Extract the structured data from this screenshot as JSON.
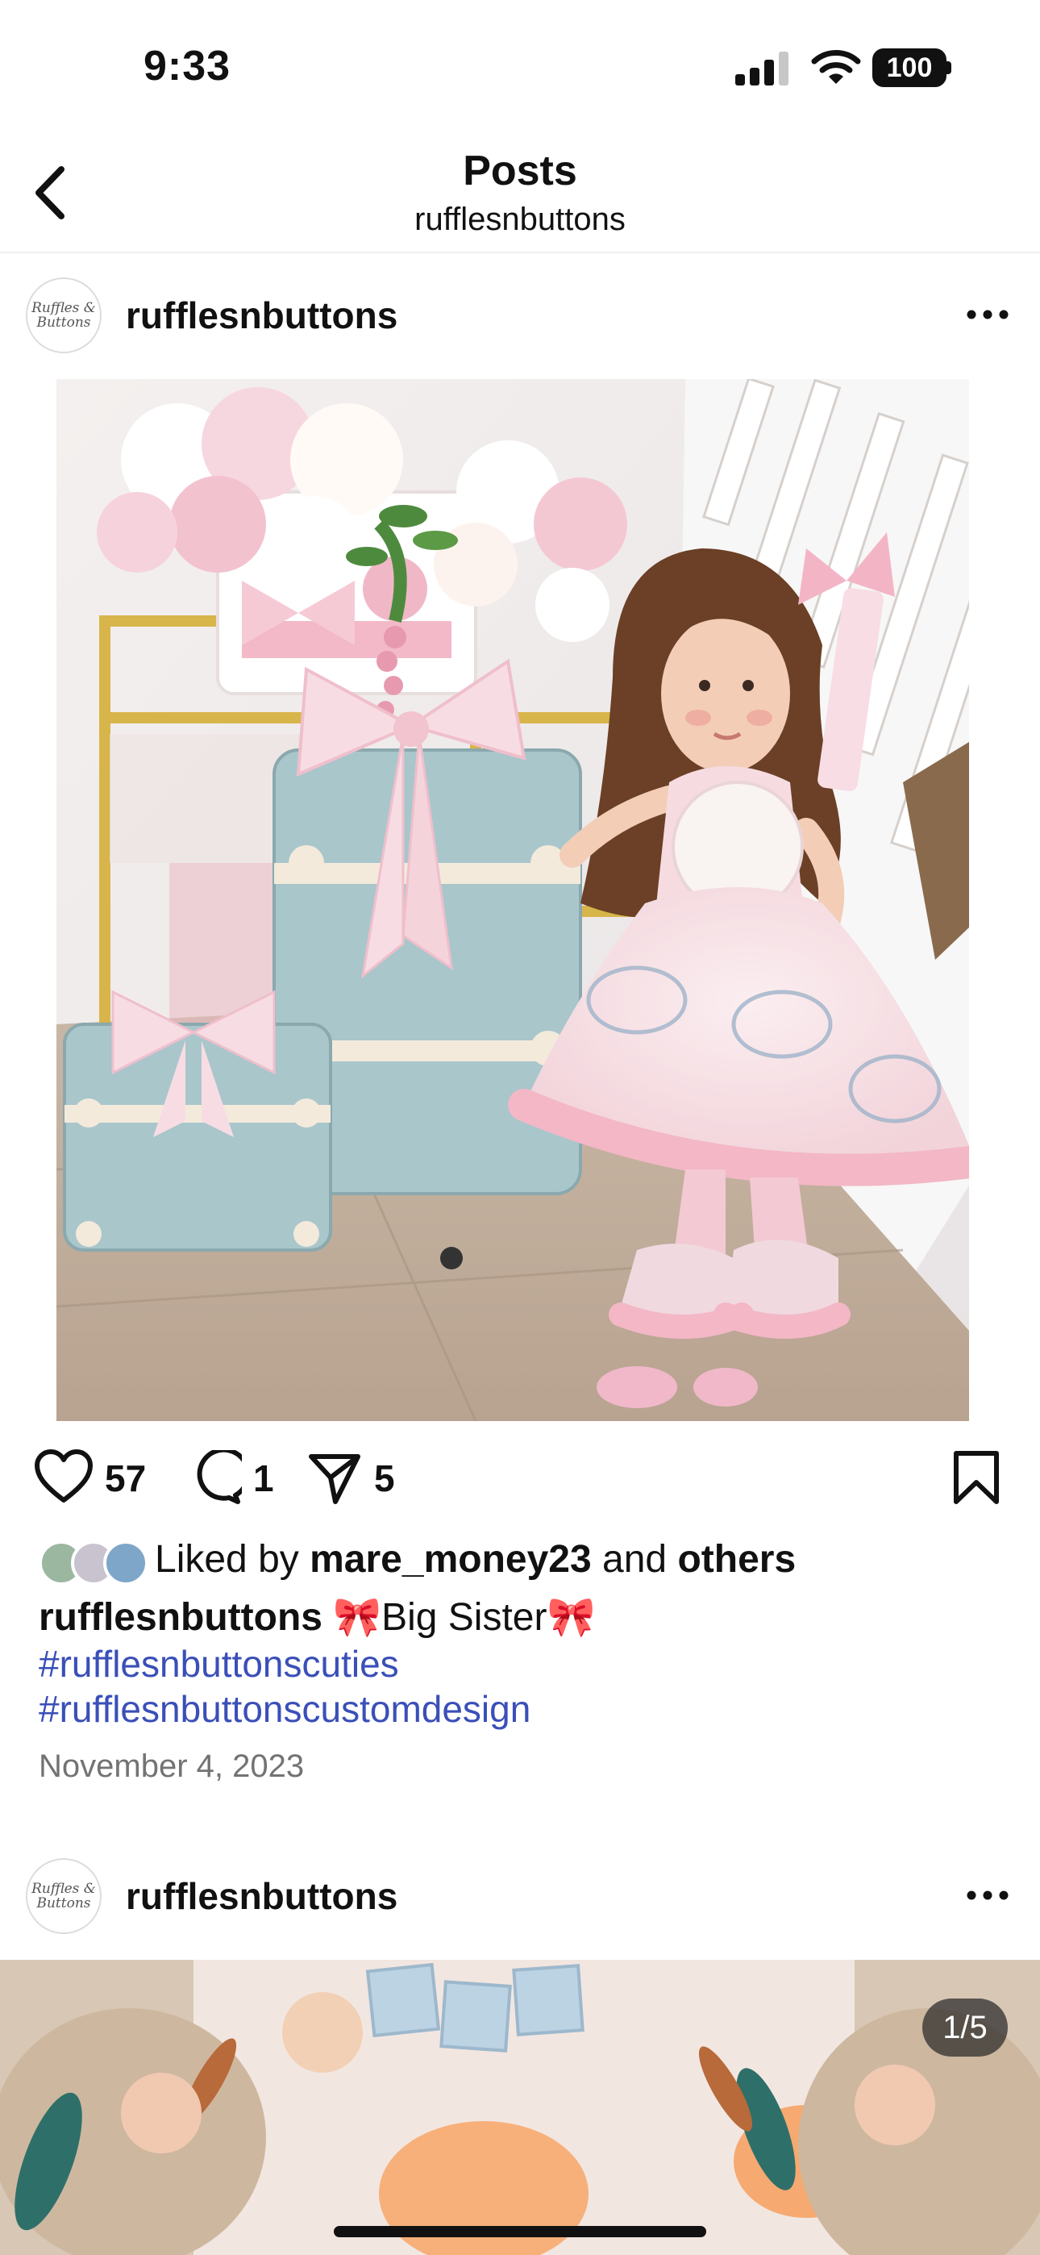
{
  "status_bar": {
    "time": "9:33",
    "battery": "100"
  },
  "header": {
    "title": "Posts",
    "subtitle": "rufflesnbuttons"
  },
  "posts": [
    {
      "username": "rufflesnbuttons",
      "avatar_text": "Ruffles & Buttons",
      "likes_count": "57",
      "comments_count": "1",
      "shares_count": "5",
      "liked_by_prefix": "Liked by",
      "liked_by_user": "mare_money23",
      "liked_by_and": "and",
      "liked_by_others": "others",
      "caption_user": "rufflesnbuttons",
      "caption_text": "🎀Big Sister🎀",
      "hashtags": [
        "#rufflesnbuttonscuties",
        "#rufflesnbuttonscustomdesign"
      ],
      "date": "November 4, 2023"
    },
    {
      "username": "rufflesnbuttons",
      "avatar_text": "Ruffles & Buttons",
      "carousel_counter": "1/5"
    }
  ],
  "colors": {
    "hashtag": "#3a4fb8",
    "date": "#737373",
    "text": "#111111"
  },
  "icons": [
    "back-icon",
    "heart-icon",
    "comment-icon",
    "share-icon",
    "bookmark-icon",
    "more-icon",
    "wifi-icon",
    "signal-icon",
    "battery-icon"
  ]
}
